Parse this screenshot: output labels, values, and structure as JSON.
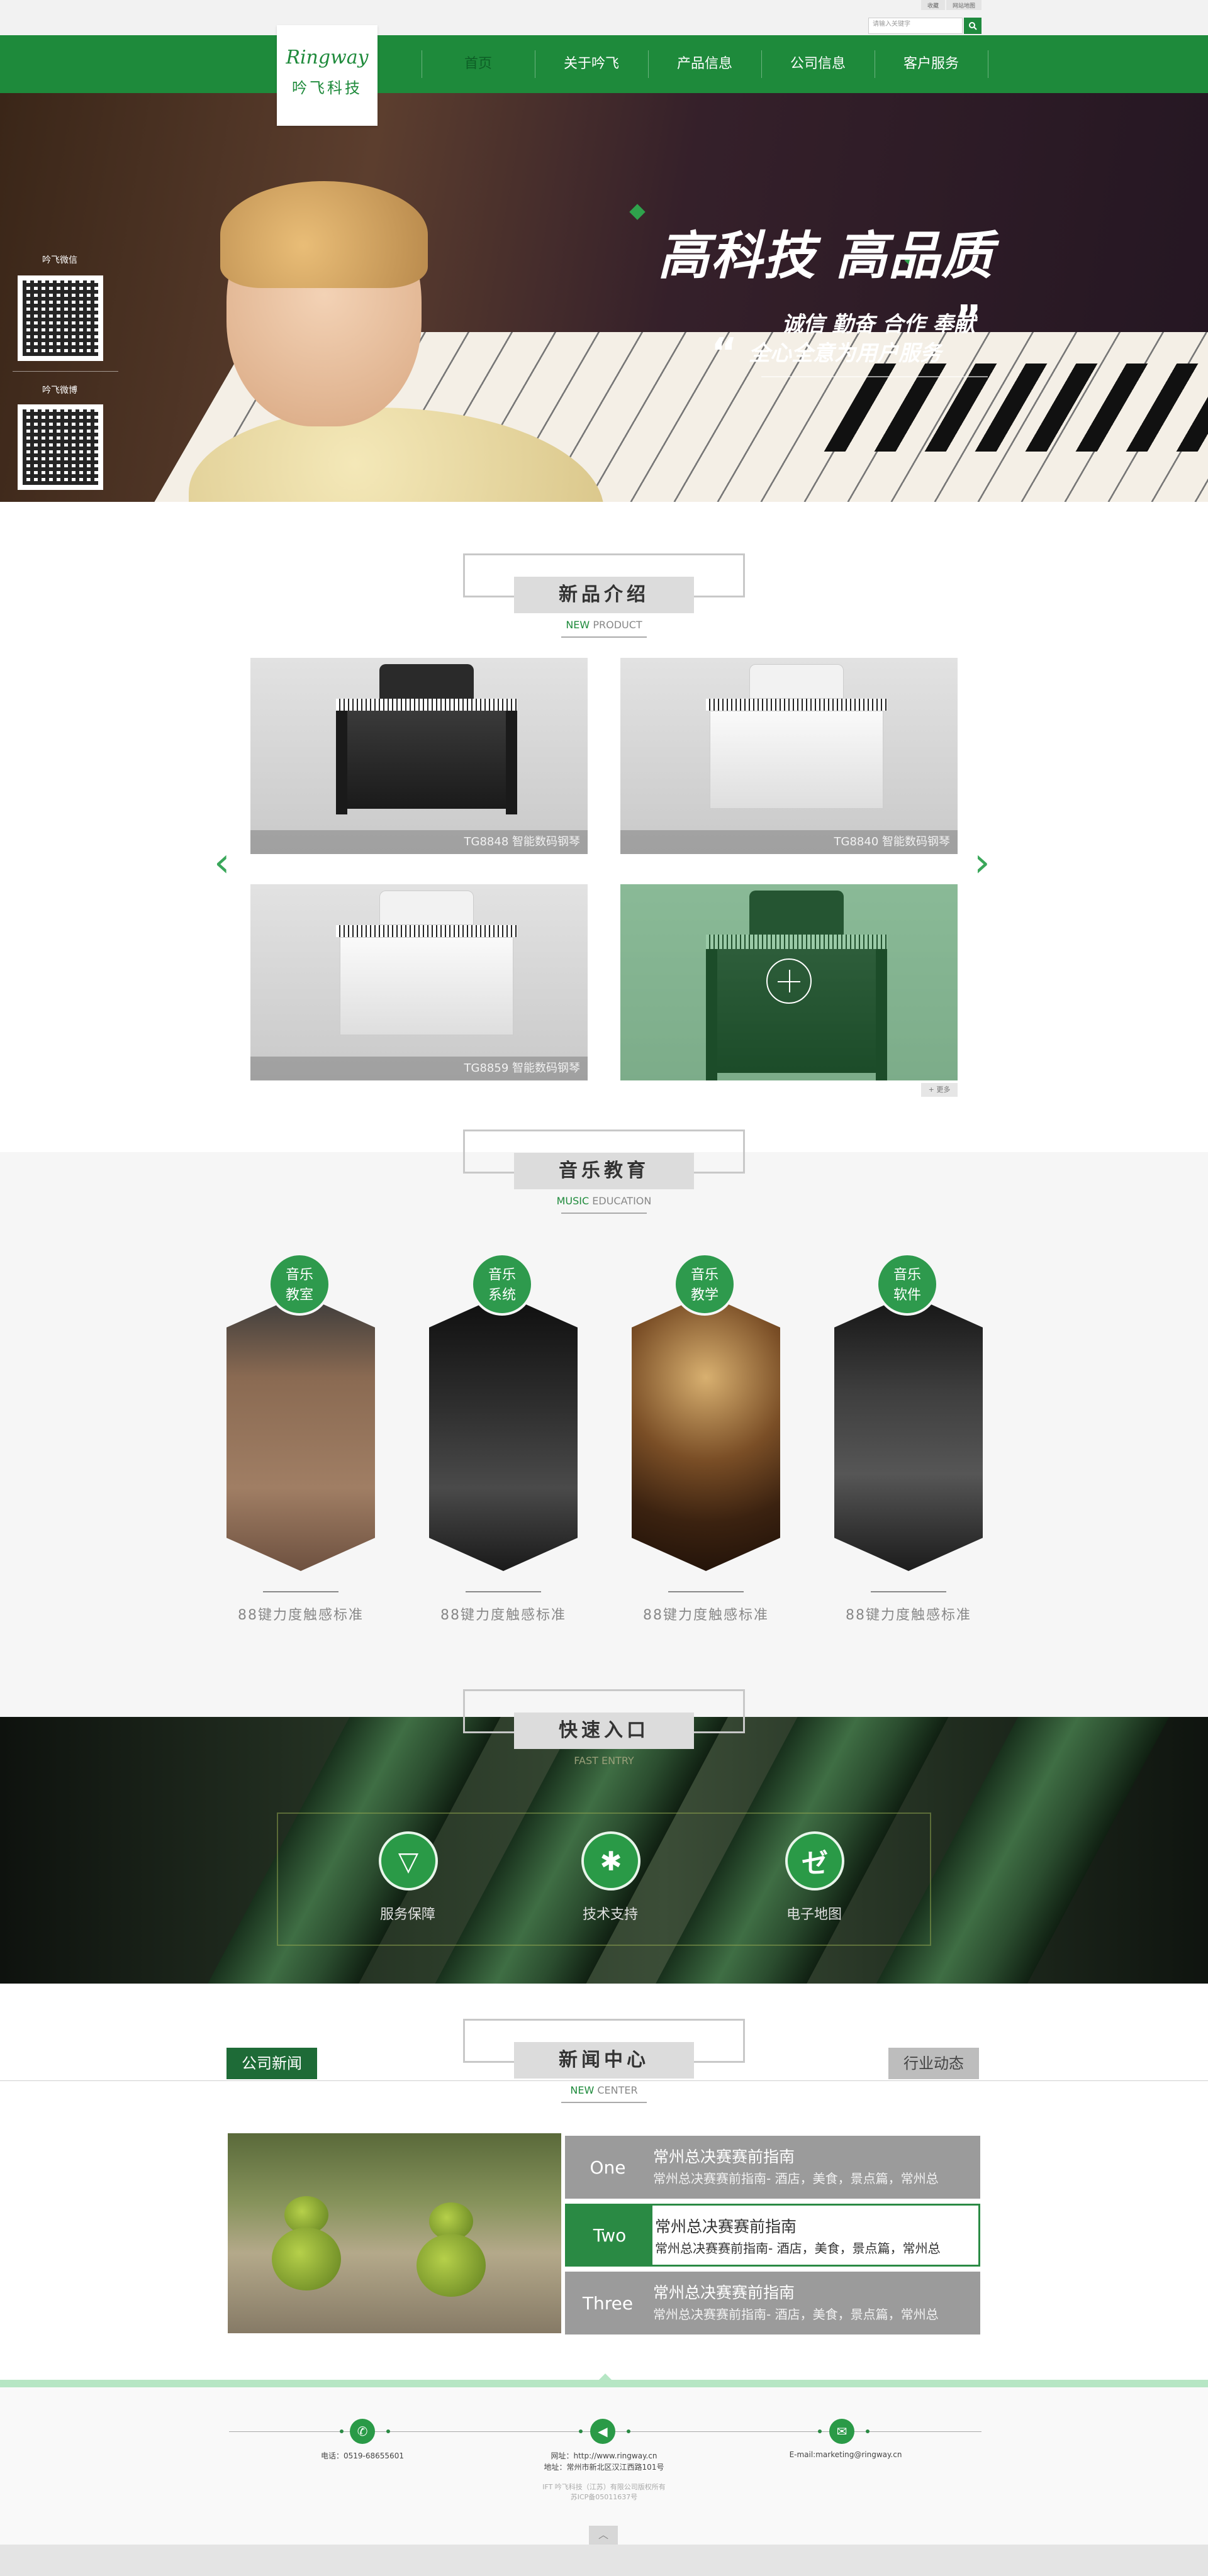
{
  "top": {
    "links": [
      "收藏",
      "网站地图"
    ],
    "search_placeholder": "请输入关键字"
  },
  "logo": {
    "script": "Ringway",
    "name": "吟飞科技"
  },
  "nav": {
    "items": [
      "首页",
      "关于吟飞",
      "产品信息",
      "公司信息",
      "客户服务"
    ],
    "active": 0
  },
  "hero": {
    "title": "高科技 高品质",
    "line1": "诚信 勤奋 合作 奉献",
    "line2": "全心全意为用户服务",
    "qr1_label": "吟飞微信",
    "qr2_label": "吟飞微博"
  },
  "products": {
    "title": "新品介绍",
    "en_green": "NEW",
    "en_gray": "PRODUCT",
    "items": [
      {
        "caption": "TG8848 智能数码钢琴",
        "color": "dark"
      },
      {
        "caption": "TG8840 智能数码钢琴",
        "color": "white"
      },
      {
        "caption": "TG8859 智能数码钢琴",
        "color": "white"
      },
      {
        "caption": "",
        "color": "dark",
        "hover": true
      }
    ],
    "prev_icon": "chevron-left-icon",
    "next_icon": "chevron-right-icon",
    "more": "+ 更多"
  },
  "education": {
    "title": "音乐教育",
    "en_green": "MUSIC",
    "en_gray": "EDUCATION",
    "items": [
      {
        "badge_line1": "音乐",
        "badge_line2": "教室",
        "text": "88键力度触感标准"
      },
      {
        "badge_line1": "音乐",
        "badge_line2": "系统",
        "text": "88键力度触感标准"
      },
      {
        "badge_line1": "音乐",
        "badge_line2": "教学",
        "text": "88键力度触感标准"
      },
      {
        "badge_line1": "音乐",
        "badge_line2": "软件",
        "text": "88键力度触感标准"
      }
    ]
  },
  "fast": {
    "title": "快速入口",
    "en": "FAST ENTRY",
    "items": [
      {
        "label": "服务保障",
        "icon": "triangle-down-icon"
      },
      {
        "label": "技术支持",
        "icon": "star-icon"
      },
      {
        "label": "电子地图",
        "icon": "map-icon"
      }
    ]
  },
  "news": {
    "title": "新闻中心",
    "en_green": "NEW",
    "en_gray": "CENTER",
    "tab_left": "公司新闻",
    "tab_right": "行业动态",
    "items": [
      {
        "num": "One",
        "title": "常州总决赛赛前指南",
        "desc": "常州总决赛赛前指南- 酒店，美食，景点篇，常州总"
      },
      {
        "num": "Two",
        "title": "常州总决赛赛前指南",
        "desc": "常州总决赛赛前指南- 酒店，美食，景点篇，常州总"
      },
      {
        "num": "Three",
        "title": "常州总决赛赛前指南",
        "desc": "常州总决赛赛前指南- 酒店，美食，景点篇，常州总"
      }
    ],
    "active": 1
  },
  "footer": {
    "phone": "电话：0519-68655601",
    "web": "网址：http://www.ringway.cn",
    "address": "地址：常州市新北区汉江西路101号",
    "email": "E-mail:marketing@ringway.cn",
    "copy1": "IFT 吟飞科技（江苏）有限公司版权所有",
    "copy2": "苏ICP备05011637号",
    "icons": [
      "phone-icon",
      "megaphone-icon",
      "mail-icon"
    ]
  },
  "colors": {
    "brand_green": "#1e8a3b",
    "accent_green": "#2a9a47",
    "news_gray": "#9b9b9b"
  }
}
